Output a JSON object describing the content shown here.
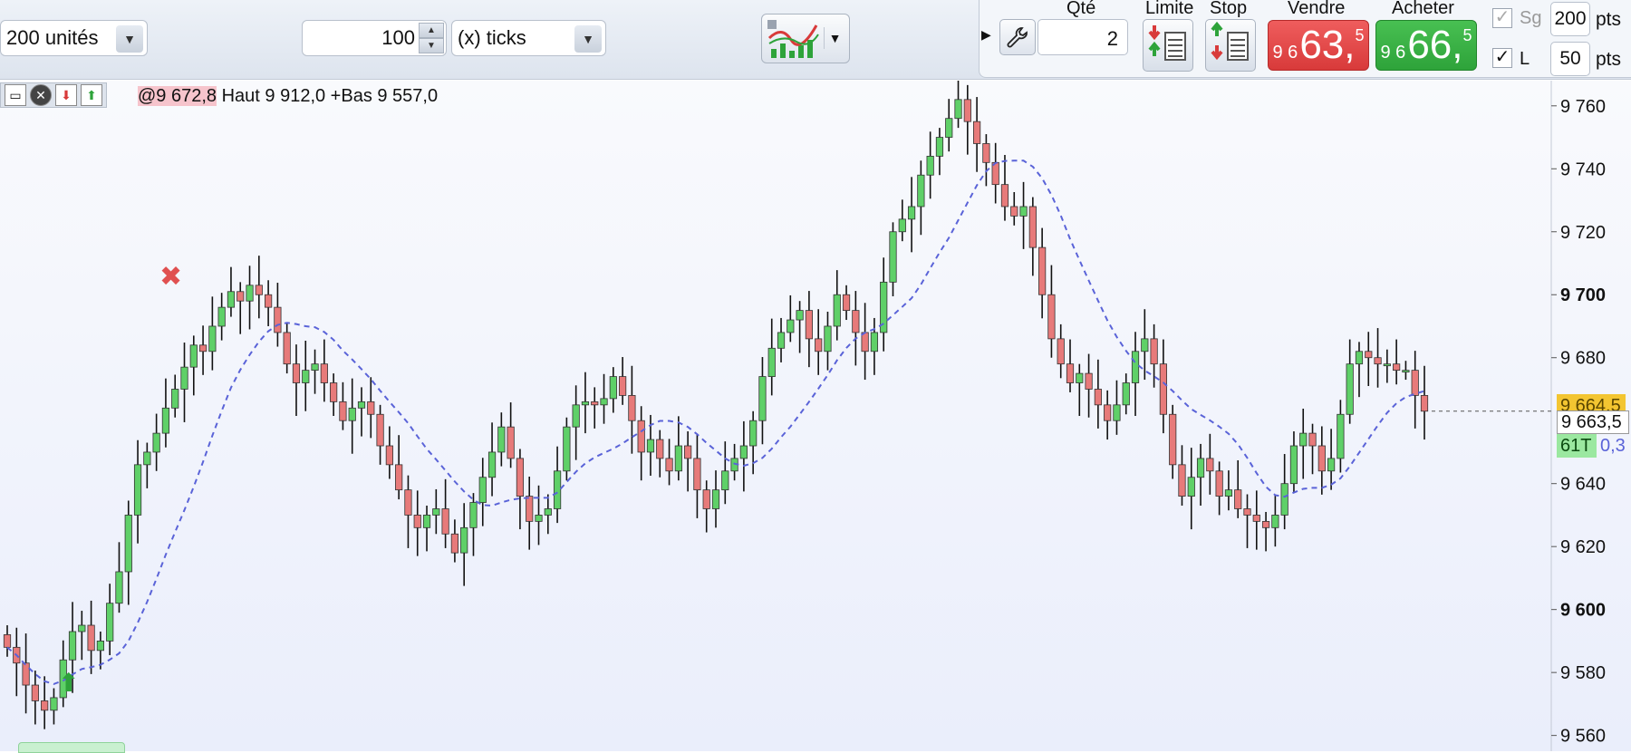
{
  "toolbar": {
    "units": "200 unités",
    "ticks_value": "100",
    "ticks_mode": "(x) ticks"
  },
  "order_panel": {
    "qty_label": "Qté",
    "qty_value": "2",
    "limit_label": "Limite",
    "stop_label": "Stop",
    "sell_label": "Vendre",
    "buy_label": "Acheter",
    "sell_price": {
      "prefix": "9 6",
      "main": "63,",
      "sup": "5"
    },
    "buy_price": {
      "prefix": "9 6",
      "main": "66,",
      "sup": "5"
    },
    "sg_label": "Sg",
    "sg_value": "200",
    "sg_unit": "pts",
    "l_label": "L",
    "l_value": "50",
    "l_unit": "pts"
  },
  "chart": {
    "legend_hl": "@9 672,8",
    "legend_text": "Haut 9 912,0 +Bas 9 557,0",
    "high_tag": "9 664,5",
    "current_tag": "9 663,5",
    "ticks_tag": "61T",
    "ma_tag": "0,3",
    "colors": {
      "up": "#5fd068",
      "down": "#e77a7a",
      "ma": "#5a63d8",
      "wick": "#111111"
    }
  },
  "chart_data": {
    "type": "candlestick",
    "yticks": [
      9760,
      9740,
      9720,
      9700,
      9680,
      9640,
      9620,
      9600,
      9580,
      9560
    ],
    "ytick_labels": [
      "9 760",
      "9 740",
      "9 720",
      "9 700",
      "9 680",
      "9 640",
      "9 620",
      "9 600",
      "9 580",
      "9 560"
    ],
    "ylim": [
      9555,
      9768
    ],
    "closes": [
      9588,
      9583,
      9576,
      9571,
      9568,
      9572,
      9584,
      9593,
      9595,
      9587,
      9590,
      9602,
      9612,
      9630,
      9646,
      9650,
      9656,
      9664,
      9670,
      9677,
      9684,
      9682,
      9690,
      9696,
      9701,
      9698,
      9703,
      9700,
      9696,
      9688,
      9678,
      9672,
      9676,
      9678,
      9672,
      9666,
      9660,
      9664,
      9666,
      9662,
      9652,
      9646,
      9638,
      9630,
      9626,
      9630,
      9632,
      9624,
      9618,
      9626,
      9634,
      9642,
      9650,
      9658,
      9648,
      9636,
      9628,
      9630,
      9632,
      9644,
      9658,
      9665,
      9666,
      9665,
      9667,
      9674,
      9668,
      9660,
      9650,
      9654,
      9648,
      9644,
      9652,
      9648,
      9638,
      9632,
      9638,
      9644,
      9648,
      9652,
      9660,
      9674,
      9683,
      9688,
      9692,
      9695,
      9686,
      9682,
      9690,
      9700,
      9695,
      9688,
      9682,
      9688,
      9704,
      9720,
      9724,
      9728,
      9738,
      9744,
      9750,
      9756,
      9762,
      9755,
      9748,
      9742,
      9735,
      9728,
      9725,
      9728,
      9715,
      9700,
      9686,
      9678,
      9672,
      9675,
      9670,
      9665,
      9660,
      9665,
      9672,
      9682,
      9686,
      9678,
      9662,
      9646,
      9636,
      9642,
      9648,
      9644,
      9636,
      9638,
      9632,
      9630,
      9628,
      9626,
      9630,
      9640,
      9652,
      9656,
      9652,
      9644,
      9648,
      9662,
      9678,
      9682,
      9680,
      9678,
      9678,
      9676,
      9676,
      9668,
      9663
    ]
  }
}
